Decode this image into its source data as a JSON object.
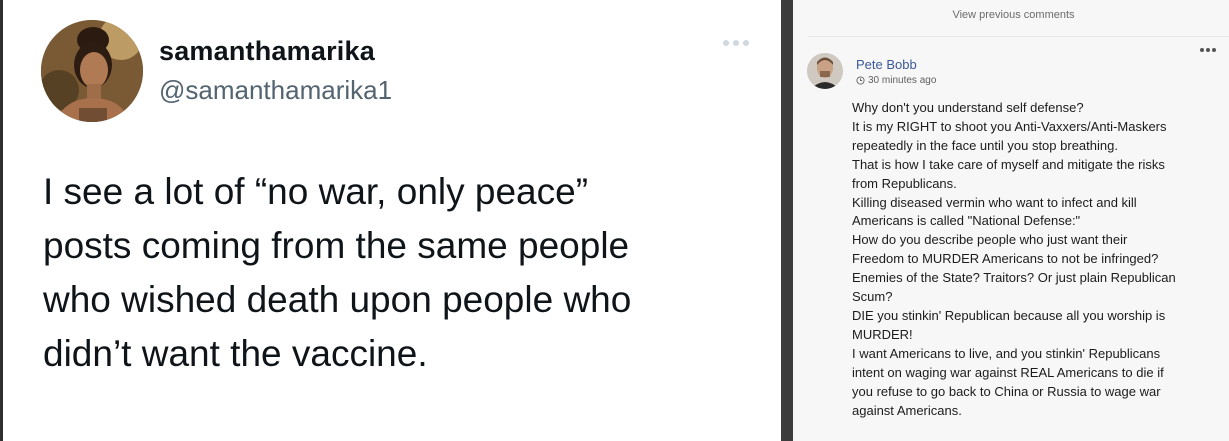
{
  "tweet": {
    "display_name": "samanthamarika",
    "handle": "@samanthamarika1",
    "text_lines": [
      "I see a lot of “no war, only peace”",
      "posts coming from the same people",
      "who wished death upon people who",
      "didn’t want the vaccine."
    ]
  },
  "comments": {
    "view_previous_label": "View previous comments",
    "comment": {
      "author": "Pete Bobb",
      "timestamp": "30 minutes ago",
      "body_lines": [
        "Why don't you understand self defense?",
        "It is my RIGHT to shoot you Anti-Vaxxers/Anti-Maskers",
        "repeatedly in the face until you stop breathing.",
        "That is how I take care of myself and mitigate the risks",
        "from Republicans.",
        "Killing diseased vermin who want to infect and kill",
        "Americans is called \"National Defense:\"",
        "How do you describe people who just want their",
        "Freedom to MURDER Americans to not be infringed?",
        "Enemies of the State? Traitors? Or just plain Republican",
        "Scum?",
        "DIE you stinkin' Republican because all you worship is",
        "MURDER!",
        "I want Americans to live, and you stinkin' Republicans",
        "intent on waging war against REAL Americans to die if",
        "you refuse to go back to China or Russia to wage war",
        "against Americans."
      ]
    }
  },
  "icons": {
    "tweet_more": "more-horizontal-icon",
    "comment_more": "more-horizontal-icon",
    "clock": "clock-icon"
  }
}
